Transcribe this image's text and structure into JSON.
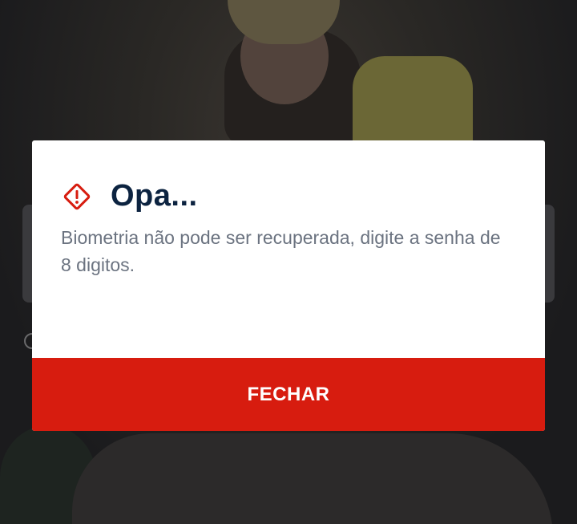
{
  "dialog": {
    "title": "Opa...",
    "icon": "warning-diamond-icon",
    "message": "Biometria não pode ser recuperada, digite a senha de 8 digitos.",
    "close_label": "FECHAR"
  },
  "colors": {
    "accent": "#d71c0f",
    "title": "#0c2340",
    "message": "#6b7380",
    "overlay": "#1c1d20"
  }
}
